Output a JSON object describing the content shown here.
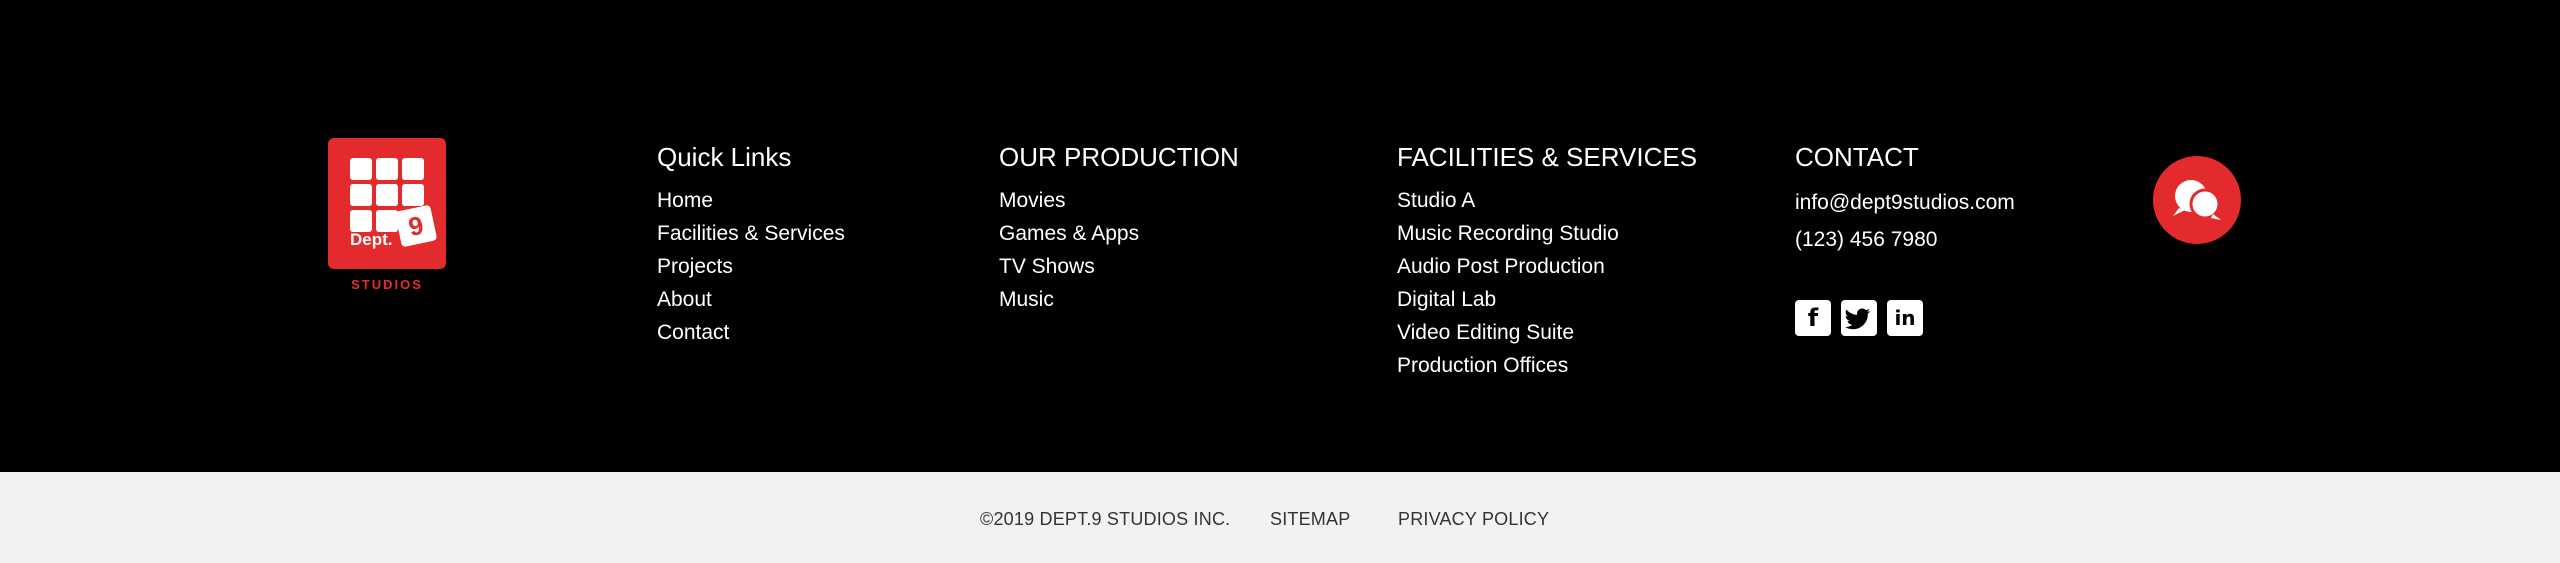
{
  "logo": {
    "dept_text": "Dept.",
    "nine_text": "9",
    "studios_text": "STUDIOS",
    "brand_color": "#e32b2e"
  },
  "quick_links": {
    "title": "Quick Links",
    "items": [
      "Home",
      "Facilities & Services",
      "Projects",
      "About",
      "Contact"
    ]
  },
  "our_production": {
    "title": "OUR PRODUCTION",
    "items": [
      "Movies",
      "Games & Apps",
      "TV Shows",
      "Music"
    ]
  },
  "facilities": {
    "title": "FACILITIES & SERVICES",
    "items": [
      "Studio A",
      "Music Recording Studio",
      "Audio Post Production",
      "Digital Lab",
      "Video Editing Suite",
      "Production Offices"
    ]
  },
  "contact": {
    "title": "CONTACT",
    "email": "info@dept9studios.com",
    "phone": "(123) 456 7980",
    "socials": [
      {
        "icon": "facebook-icon",
        "glyph": "f"
      },
      {
        "icon": "twitter-icon",
        "glyph": "t"
      },
      {
        "icon": "linkedin-icon",
        "glyph": "in"
      }
    ]
  },
  "chat": {
    "icon": "chat-bubbles-icon"
  },
  "bottom_bar": {
    "copyright": "©2019 DEPT.9 STUDIOS INC.",
    "sitemap": "SITEMAP",
    "privacy": "PRIVACY POLICY"
  }
}
